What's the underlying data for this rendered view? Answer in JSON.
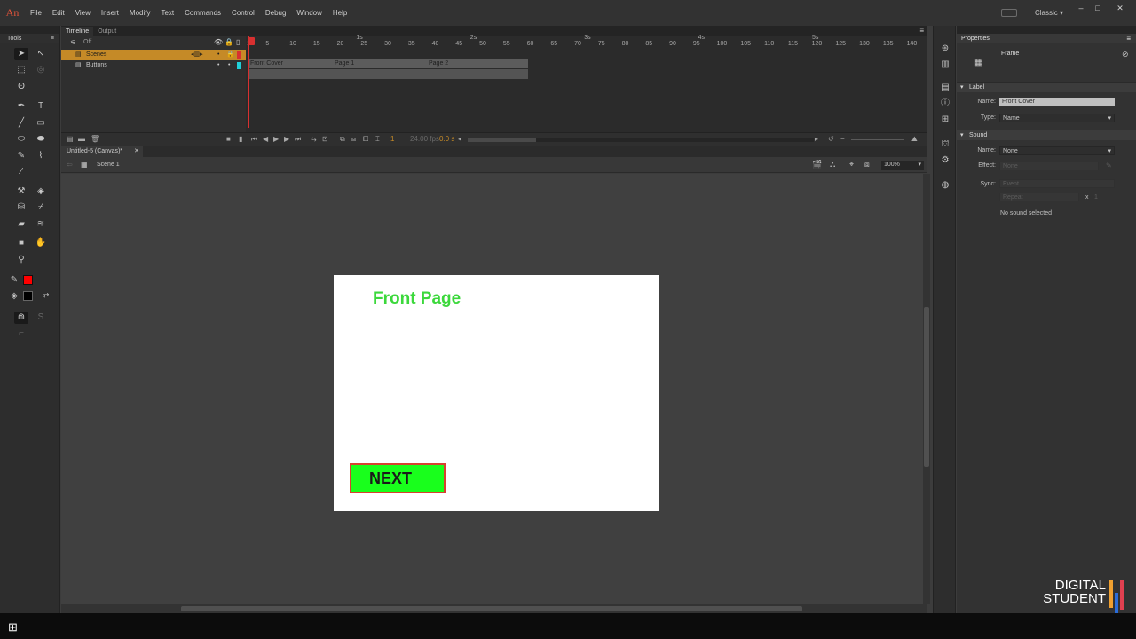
{
  "app": {
    "logo": "An"
  },
  "menu": [
    "File",
    "Edit",
    "View",
    "Insert",
    "Modify",
    "Text",
    "Commands",
    "Control",
    "Debug",
    "Window",
    "Help"
  ],
  "workspace": "Classic",
  "tools_panel": {
    "title": "Tools"
  },
  "timeline": {
    "tabs": [
      "Timeline",
      "Output"
    ],
    "onion_label": "Off",
    "layers": [
      {
        "name": "Scenes",
        "selected": true
      },
      {
        "name": "Buttons",
        "selected": false
      }
    ],
    "ruler_numbers": [
      "1",
      "5",
      "10",
      "15",
      "20",
      "25",
      "30",
      "35",
      "40",
      "45",
      "50",
      "55",
      "60",
      "65",
      "70",
      "75",
      "80",
      "85",
      "90",
      "95",
      "100",
      "105",
      "110",
      "115",
      "120",
      "125",
      "130",
      "135",
      "140"
    ],
    "seconds": [
      "1s",
      "2s",
      "3s",
      "4s",
      "5s"
    ],
    "frame_labels": [
      "Front Cover",
      "Page 1",
      "Page 2"
    ],
    "current_frame": "1",
    "fps": "24.00 fps",
    "elapsed": "0.0 s"
  },
  "document": {
    "tab": "Untitled-5 (Canvas)*",
    "scene": "Scene 1",
    "zoom": "100%"
  },
  "stage": {
    "title": "Front Page",
    "button_label": "NEXT",
    "title_color": "#3cd83c",
    "button_color": "#19ff1c"
  },
  "properties": {
    "title": "Properties",
    "object_type": "Frame",
    "label_section": "Label",
    "name_label": "Name:",
    "name_value": "Front Cover",
    "type_label": "Type:",
    "type_value": "Name",
    "sound_section": "Sound",
    "sound_name_label": "Name:",
    "sound_name_value": "None",
    "effect_label": "Effect:",
    "effect_value": "None",
    "sync_label": "Sync:",
    "sync_value": "Event",
    "repeat_value": "Repeat",
    "repeat_x": "x",
    "repeat_count": "1",
    "no_sound": "No sound selected"
  },
  "watermark": {
    "line1": "DIGITAL",
    "line2": "STUDENT"
  }
}
